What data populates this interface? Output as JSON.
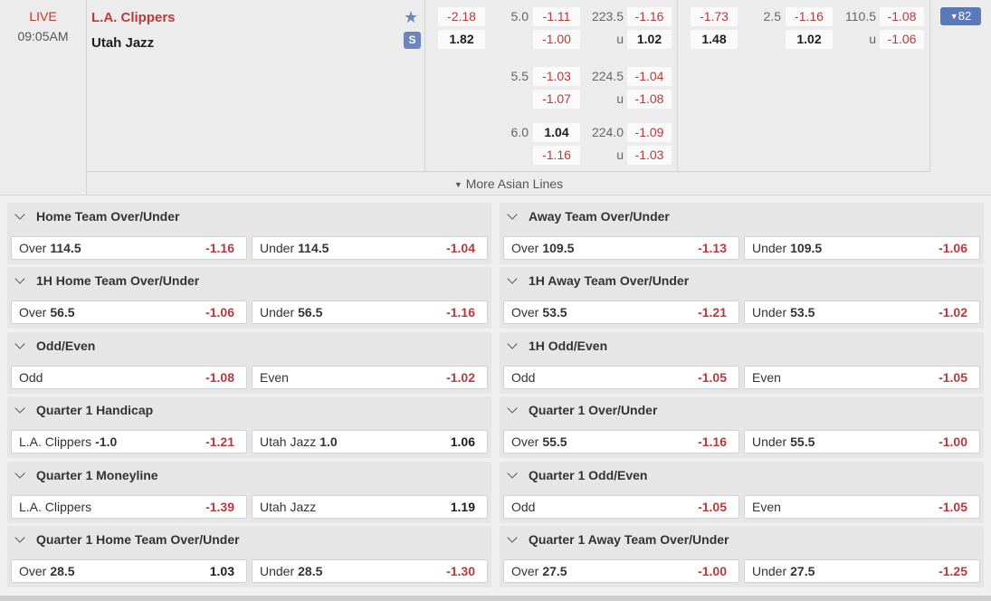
{
  "match": {
    "status": "LIVE",
    "time": "09:05AM",
    "home_team": "L.A. Clippers",
    "away_team": "Utah Jazz",
    "favorite_icon": "star-icon",
    "stream_icon": "stream-icon",
    "more_count": "82",
    "more_lines": "More Asian Lines"
  },
  "full_time": {
    "moneyline": {
      "home": "-2.18",
      "away": "1.82"
    },
    "lines": [
      {
        "hcp": "5.0",
        "hcp_home": "-1.11",
        "hcp_away": "-1.00",
        "total": "223.5",
        "over": "-1.16",
        "u": "u",
        "under": "1.02"
      },
      {
        "hcp": "5.5",
        "hcp_home": "-1.03",
        "hcp_away": "-1.07",
        "total": "224.5",
        "over": "-1.04",
        "u": "u",
        "under": "-1.08"
      },
      {
        "hcp": "6.0",
        "hcp_home": "1.04",
        "hcp_away": "-1.16",
        "total": "224.0",
        "over": "-1.09",
        "u": "u",
        "under": "-1.03"
      }
    ]
  },
  "first_half": {
    "moneyline": {
      "home": "-1.73",
      "away": "1.48"
    },
    "line": {
      "hcp": "2.5",
      "hcp_home": "-1.16",
      "hcp_away": "1.02",
      "total": "110.5",
      "over": "-1.08",
      "u": "u",
      "under": "-1.06"
    }
  },
  "markets": [
    {
      "title": "Home Team Over/Under",
      "sel1": {
        "label": "Over",
        "line": "114.5",
        "odds": "-1.16"
      },
      "sel2": {
        "label": "Under",
        "line": "114.5",
        "odds": "-1.04"
      }
    },
    {
      "title": "Away Team Over/Under",
      "sel1": {
        "label": "Over",
        "line": "109.5",
        "odds": "-1.13"
      },
      "sel2": {
        "label": "Under",
        "line": "109.5",
        "odds": "-1.06"
      }
    },
    {
      "title": "1H Home Team Over/Under",
      "sel1": {
        "label": "Over",
        "line": "56.5",
        "odds": "-1.06"
      },
      "sel2": {
        "label": "Under",
        "line": "56.5",
        "odds": "-1.16"
      }
    },
    {
      "title": "1H Away Team Over/Under",
      "sel1": {
        "label": "Over",
        "line": "53.5",
        "odds": "-1.21"
      },
      "sel2": {
        "label": "Under",
        "line": "53.5",
        "odds": "-1.02"
      }
    },
    {
      "title": "Odd/Even",
      "sel1": {
        "label": "Odd",
        "line": "",
        "odds": "-1.08"
      },
      "sel2": {
        "label": "Even",
        "line": "",
        "odds": "-1.02"
      }
    },
    {
      "title": "1H Odd/Even",
      "sel1": {
        "label": "Odd",
        "line": "",
        "odds": "-1.05"
      },
      "sel2": {
        "label": "Even",
        "line": "",
        "odds": "-1.05"
      }
    },
    {
      "title": "Quarter 1 Handicap",
      "sel1": {
        "label": "L.A. Clippers",
        "line": "-1.0",
        "odds": "-1.21"
      },
      "sel2": {
        "label": "Utah Jazz",
        "line": "1.0",
        "odds": "1.06"
      }
    },
    {
      "title": "Quarter 1 Over/Under",
      "sel1": {
        "label": "Over",
        "line": "55.5",
        "odds": "-1.16"
      },
      "sel2": {
        "label": "Under",
        "line": "55.5",
        "odds": "-1.00"
      }
    },
    {
      "title": "Quarter 1 Moneyline",
      "sel1": {
        "label": "L.A. Clippers",
        "line": "",
        "odds": "-1.39"
      },
      "sel2": {
        "label": "Utah Jazz",
        "line": "",
        "odds": "1.19"
      }
    },
    {
      "title": "Quarter 1 Odd/Even",
      "sel1": {
        "label": "Odd",
        "line": "",
        "odds": "-1.05"
      },
      "sel2": {
        "label": "Even",
        "line": "",
        "odds": "-1.05"
      }
    },
    {
      "title": "Quarter 1 Home Team Over/Under",
      "sel1": {
        "label": "Over",
        "line": "28.5",
        "odds": "1.03"
      },
      "sel2": {
        "label": "Under",
        "line": "28.5",
        "odds": "-1.30"
      }
    },
    {
      "title": "Quarter 1 Away Team Over/Under",
      "sel1": {
        "label": "Over",
        "line": "27.5",
        "odds": "-1.00"
      },
      "sel2": {
        "label": "Under",
        "line": "27.5",
        "odds": "-1.25"
      }
    }
  ],
  "colors": {
    "negative": "#b83a3a",
    "positive": "#1e1e1e",
    "accent": "#5b78b8"
  }
}
